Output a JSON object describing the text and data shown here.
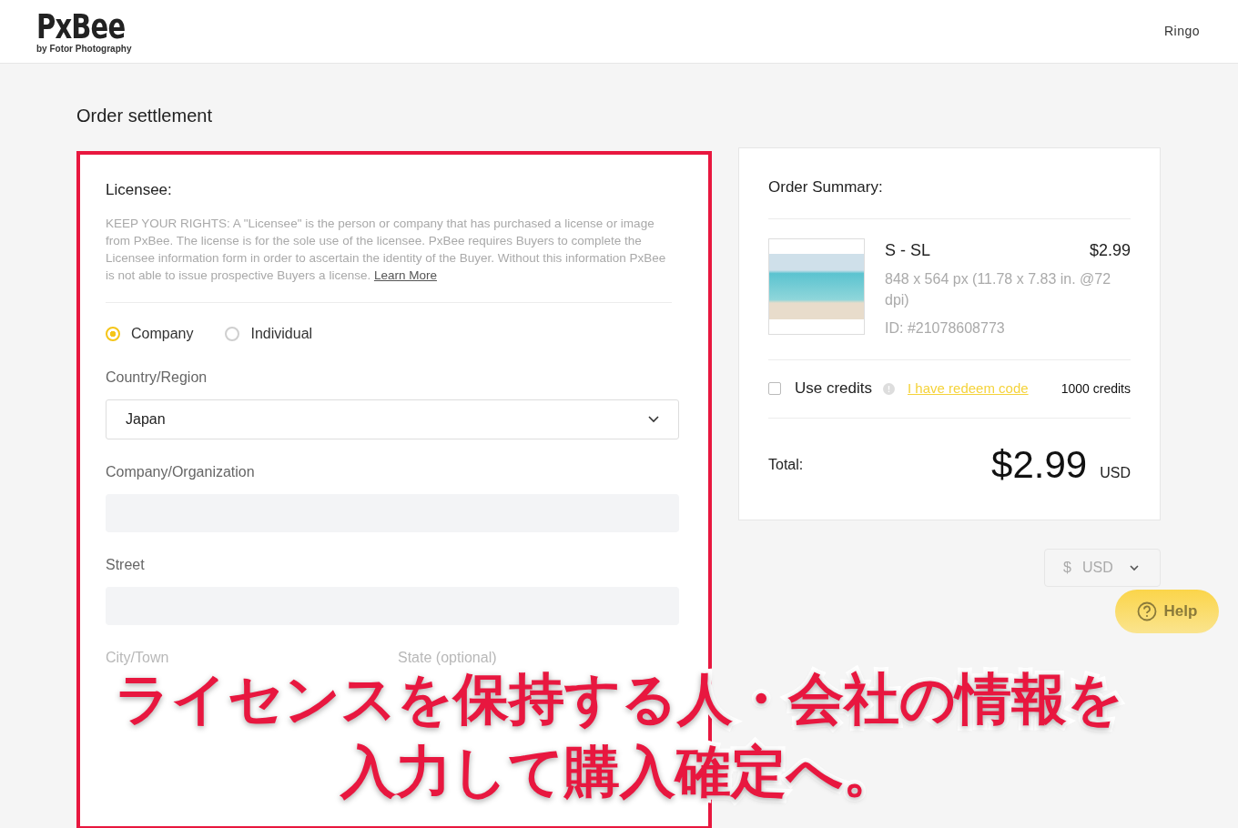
{
  "header": {
    "logo": "PxBee",
    "tagline": "by Fotor Photography",
    "user": "Ringo"
  },
  "page_title": "Order settlement",
  "licensee": {
    "heading": "Licensee:",
    "notice": "KEEP YOUR RIGHTS: A \"Licensee\" is the person or company that has purchased a license or image from PxBee. The license is for the sole use of the licensee. PxBee requires Buyers to complete the Licensee information form in order to ascertain the identity of the Buyer. Without this information PxBee is not able to issue prospective Buyers a license.",
    "learn_more": "Learn More",
    "types": [
      {
        "label": "Company",
        "selected": true
      },
      {
        "label": "Individual",
        "selected": false
      }
    ],
    "fields": [
      {
        "kind": "select",
        "label": "Country/Region",
        "value": "Japan"
      },
      {
        "kind": "text",
        "label": "Company/Organization"
      },
      {
        "kind": "text",
        "label": "Street"
      }
    ],
    "split_labels": [
      "City/Town",
      "State (optional)"
    ]
  },
  "order_summary": {
    "heading": "Order Summary:",
    "item": {
      "title": "S - SL",
      "price": "$2.99",
      "dimensions": "848 x 564 px (11.78 x 7.83 in. @72 dpi)",
      "id": "ID: #21078608773"
    },
    "use_credits": {
      "label": "Use credits",
      "checked": false
    },
    "redeem_link": "I have redeem code",
    "credits": "1000 credits",
    "total": {
      "label": "Total:",
      "amount": "$2.99",
      "currency": "USD"
    }
  },
  "currency_select": {
    "symbol": "$",
    "value": "USD"
  },
  "help_button": "Help",
  "caption": [
    "ライセンスを保持する人・会社の情報を",
    "入力して購入確定へ。"
  ]
}
